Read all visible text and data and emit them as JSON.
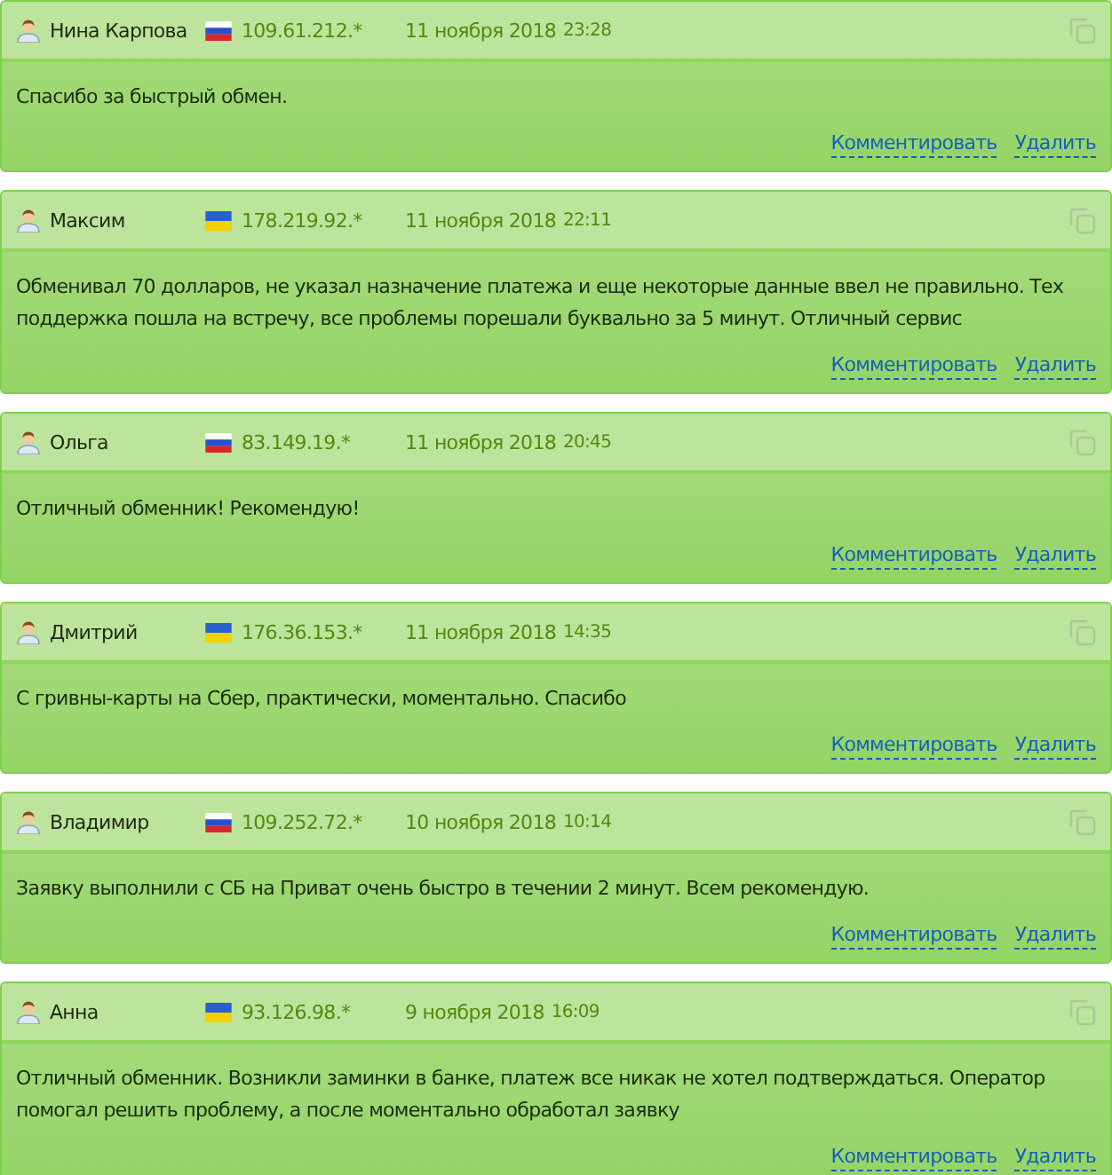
{
  "reviews": [
    {
      "author": "Нина Карпова",
      "kind": "ru",
      "ip": "109.61.212.*",
      "date": "11 ноября 2018",
      "time": "23:28",
      "text": "Спасибо за быстрый обмен.",
      "comment_link": "Комментировать",
      "delete_link": "Удалить"
    },
    {
      "author": "Максим",
      "kind": "ua",
      "ip": "178.219.92.*",
      "date": "11 ноября 2018",
      "time": "22:11",
      "text": "Обменивал 70 долларов, не указал назначение платежа и еще некоторые данные ввел не правильно. Тех поддержка пошла на встречу, все проблемы порешали буквально за 5 минут. Отличный сервис",
      "comment_link": "Комментировать",
      "delete_link": "Удалить"
    },
    {
      "author": "Ольга",
      "kind": "ru",
      "ip": "83.149.19.*",
      "date": "11 ноября 2018",
      "time": "20:45",
      "text": "Отличный обменник! Рекомендую!",
      "comment_link": "Комментировать",
      "delete_link": "Удалить"
    },
    {
      "author": "Дмитрий",
      "kind": "ua",
      "ip": "176.36.153.*",
      "date": "11 ноября 2018",
      "time": "14:35",
      "text": "С гривны-карты на Сбер, практически, моментально. Спасибо",
      "comment_link": "Комментировать",
      "delete_link": "Удалить"
    },
    {
      "author": "Владимир",
      "kind": "ru",
      "ip": "109.252.72.*",
      "date": "10 ноября 2018",
      "time": "10:14",
      "text": "Заявку выполнили с СБ на Приват очень быстро в течении 2 минут. Всем рекомендую.",
      "comment_link": "Комментировать",
      "delete_link": "Удалить"
    },
    {
      "author": "Анна",
      "kind": "ua",
      "ip": "93.126.98.*",
      "date": "9 ноября 2018",
      "time": "16:09",
      "text": "Отличный обменник. Возникли заминки в банке, платеж все никак не хотел подтверждаться. Оператор помогал решить проблему, а после моментально обработал заявку",
      "comment_link": "Комментировать",
      "delete_link": "Удалить"
    }
  ]
}
